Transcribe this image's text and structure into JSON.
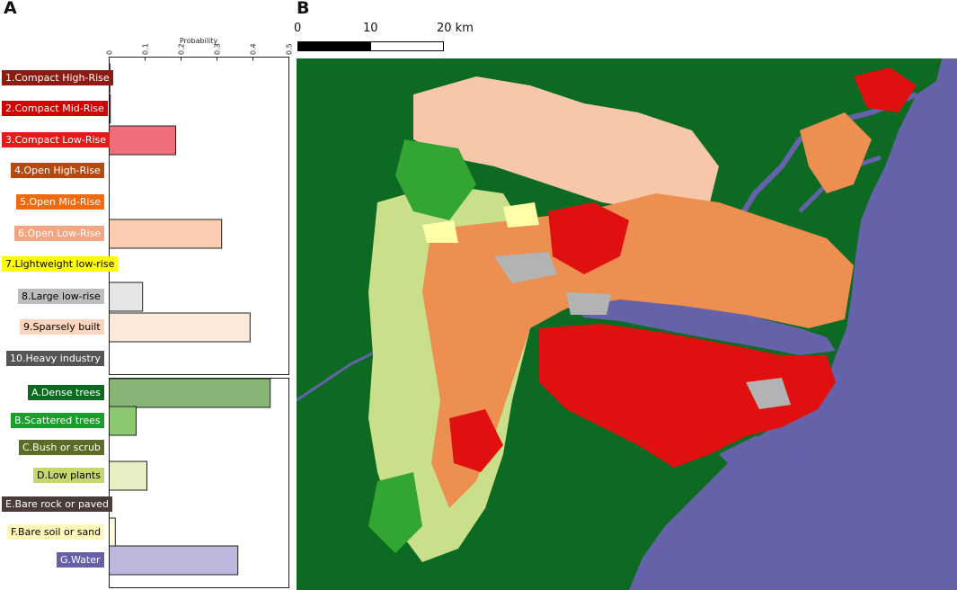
{
  "panel_a": {
    "letter": "A",
    "axis_title": "Probability",
    "ticks": [
      "0",
      "0.1",
      "0.2",
      "0.3",
      "0.4",
      "0.5"
    ]
  },
  "panel_b": {
    "letter": "B",
    "scalebar": {
      "labels": [
        "0",
        "10",
        "20 km"
      ]
    }
  },
  "chart_data": {
    "type": "bar",
    "orientation": "horizontal",
    "xlabel": "Probability",
    "xlim": [
      0,
      0.5
    ],
    "groups": [
      {
        "categories": [
          "1.Compact High-Rise",
          "2.Compact Mid-Rise",
          "3.Compact Low-Rise",
          "4.Open High-Rise",
          "5.Open Mid-Rise",
          "6.Open Low-Rise",
          "7.Lightweight low-rise",
          "8.Large low-rise",
          "9.Sparsely built",
          "10.Heavy industry"
        ],
        "values": [
          0.001,
          0.003,
          0.185,
          0,
          0,
          0.313,
          0,
          0.093,
          0.392,
          0
        ],
        "bar_colors": [
          "#8c1c13",
          "#d10000",
          "#ee6f7b",
          "#b54a10",
          "#ff5a00",
          "#fbccaf",
          "#ffff00",
          "#e6e6e6",
          "#fde8dc",
          "#555555"
        ],
        "label_bg": [
          "#8c1c13",
          "#d10000",
          "#e41a1c",
          "#b54a10",
          "#f26a10",
          "#f4a582",
          "#ffff00",
          "#bdbdbd",
          "#fcd5bf",
          "#555555"
        ],
        "label_fg": [
          "#ffffff",
          "#ffffff",
          "#ffffff",
          "#ffffff",
          "#ffffff",
          "#ffffff",
          "#000000",
          "#000000",
          "#000000",
          "#ffffff"
        ]
      },
      {
        "categories": [
          "A.Dense trees",
          "B.Scattered trees",
          "C.Bush or scrub",
          "D.Low plants",
          "E.Bare rock or paved",
          "F.Bare soil or sand",
          "G.Water"
        ],
        "values": [
          0.448,
          0.075,
          0,
          0.105,
          0,
          0.017,
          0.358
        ],
        "bar_colors": [
          "#87b576",
          "#8cc872",
          "#6b8e23",
          "#e5efc3",
          "#4a3b36",
          "#fefdde",
          "#bfb6de"
        ],
        "label_bg": [
          "#0b6b1e",
          "#1a9e2c",
          "#5b6c24",
          "#c8d66e",
          "#4a3b36",
          "#fff8b8",
          "#6560a8"
        ],
        "label_fg": [
          "#ffffff",
          "#ffffff",
          "#ffffff",
          "#000000",
          "#ffffff",
          "#000000",
          "#ffffff"
        ]
      }
    ]
  },
  "map_colors": {
    "water": "#6562aa",
    "dense_trees": "#0c6a23",
    "scattered_trees": "#33a532",
    "low_plants": "#c9df8a",
    "sparsely_built": "#f7c7a9",
    "open_low_rise": "#ee8f52",
    "compact_low_rise": "#e01010",
    "large_low_rise": "#b3b3b3",
    "lightweight": "#ffffa8"
  }
}
